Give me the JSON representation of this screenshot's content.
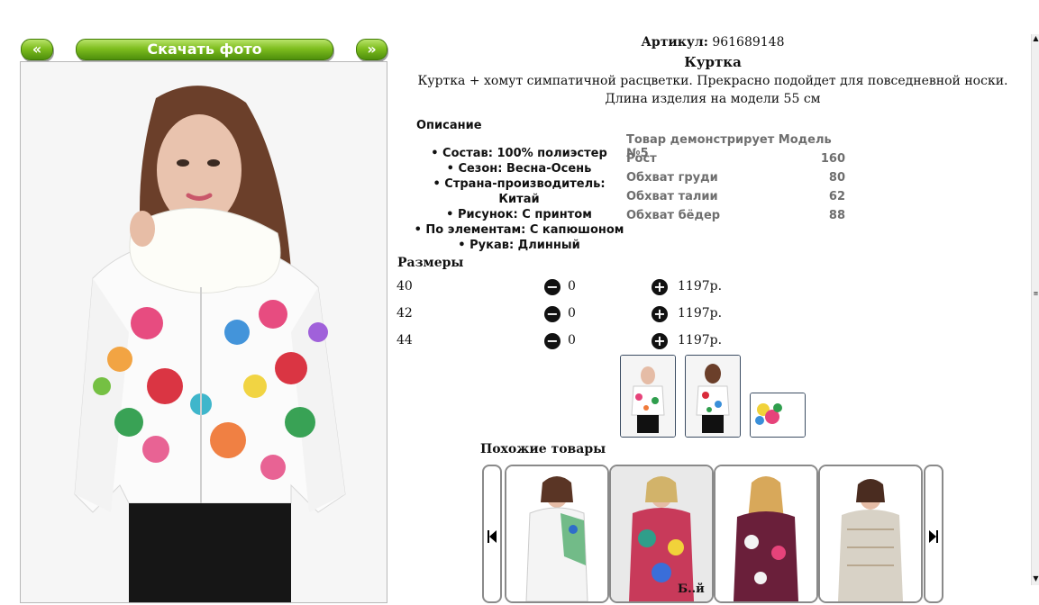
{
  "nav": {
    "prev_label": "«",
    "download_label": "Скачать фото",
    "next_label": "»"
  },
  "product": {
    "article_label": "Артикул:",
    "article_value": "961689148",
    "name": "Куртка",
    "description": "Куртка + хомут симпатичной расцветки. Прекрасно подойдет для повседневной носки. Длина изделия на модели 55 см"
  },
  "specs": {
    "heading": "Описание",
    "items": [
      "Состав: 100% полиэстер",
      "Сезон: Весна-Осень",
      "Страна-производитель: Китай",
      "Рисунок: С принтом",
      "По элементам: С капюшоном",
      "Рукав: Длинный"
    ]
  },
  "model": {
    "heading": "Товар демонстрирует Модель №5",
    "rows": [
      {
        "label": "Рост",
        "value": "160"
      },
      {
        "label": "Обхват груди",
        "value": "80"
      },
      {
        "label": "Обхват талии",
        "value": "62"
      },
      {
        "label": "Обхват бёдер",
        "value": "88"
      }
    ]
  },
  "sizes": {
    "heading": "Размеры",
    "minus_icon": "minus-circle-icon",
    "plus_icon": "plus-circle-icon",
    "rows": [
      {
        "size": "40",
        "qty": "0",
        "price": "1197р."
      },
      {
        "size": "42",
        "qty": "0",
        "price": "1197р."
      },
      {
        "size": "44",
        "qty": "0",
        "price": "1197р."
      }
    ]
  },
  "similar": {
    "heading": "Похожие товары",
    "bottom_partial_text": "Б..й"
  },
  "colors": {
    "accent_green": "#7fbe1f",
    "thumb_border": "#3c4d63"
  }
}
